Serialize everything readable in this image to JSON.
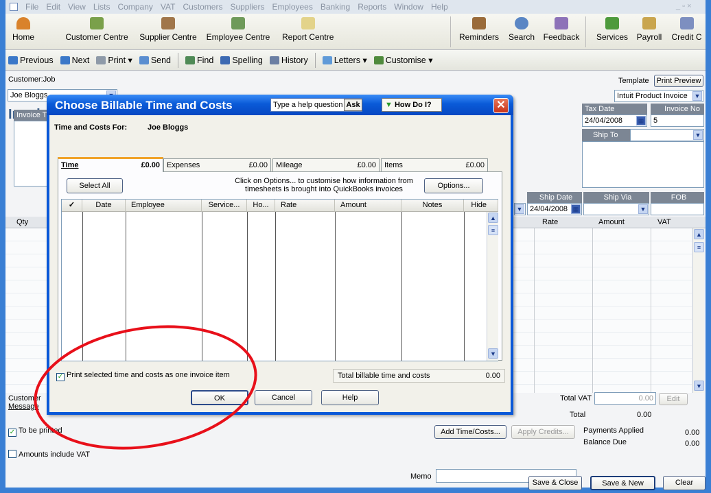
{
  "menu": [
    "File",
    "Edit",
    "View",
    "Lists",
    "Company",
    "VAT",
    "Customers",
    "Suppliers",
    "Employees",
    "Banking",
    "Reports",
    "Window",
    "Help"
  ],
  "icon_toolbar": {
    "left": [
      {
        "label": "Home",
        "icon": "house-icon"
      },
      {
        "label": "Customer Centre",
        "icon": "customer-centre-icon"
      },
      {
        "label": "Supplier Centre",
        "icon": "supplier-centre-icon"
      },
      {
        "label": "Employee Centre",
        "icon": "employee-centre-icon"
      },
      {
        "label": "Report Centre",
        "icon": "report-centre-icon"
      }
    ],
    "right": [
      {
        "label": "Reminders",
        "icon": "reminders-icon"
      },
      {
        "label": "Search",
        "icon": "search-icon"
      },
      {
        "label": "Feedback",
        "icon": "feedback-icon"
      },
      {
        "label": "Services",
        "icon": "services-icon"
      },
      {
        "label": "Payroll",
        "icon": "payroll-icon"
      },
      {
        "label": "Credit C",
        "icon": "credit-card-icon"
      }
    ]
  },
  "action_toolbar": {
    "previous": "Previous",
    "next": "Next",
    "print": "Print",
    "send": "Send",
    "find": "Find",
    "spelling": "Spelling",
    "history": "History",
    "letters": "Letters",
    "customise": "Customise"
  },
  "invoice": {
    "customer_job_label": "Customer:Job",
    "customer_job_value": "Joe Bloggs",
    "title": "Invoi",
    "template_label": "Template",
    "print_preview": "Print Preview",
    "template_value": "Intuit Product Invoice",
    "tax_date_label": "Tax Date",
    "tax_date": "24/04/2008",
    "invoice_no_label": "Invoice No",
    "invoice_no": "5",
    "ship_to_label": "Ship To",
    "invoice_to_label": "Invoice T",
    "ship_date_label": "Ship Date",
    "ship_date": "24/04/2008",
    "ship_via_label": "Ship Via",
    "fob_label": "FOB",
    "col_qty": "Qty",
    "col_rate": "Rate",
    "col_amount": "Amount",
    "col_vat": "VAT",
    "customer_message_label1": "Customer",
    "customer_message_label2": "Message",
    "total_vat_label": "Total VAT",
    "total_vat": "0.00",
    "edit": "Edit",
    "total_label": "Total",
    "total": "0.00",
    "to_be_printed": "To be printed",
    "amounts_include_vat": "Amounts include VAT",
    "add_time_costs": "Add Time/Costs...",
    "apply_credits": "Apply Credits...",
    "payments_applied_label": "Payments Applied",
    "payments_applied": "0.00",
    "balance_due_label": "Balance Due",
    "balance_due": "0.00",
    "memo_label": "Memo",
    "save_close": "Save & Close",
    "save_new": "Save & New",
    "clear": "Clear"
  },
  "dialog": {
    "title": "Choose Billable Time and Costs",
    "help_placeholder": "Type a help question",
    "ask": "Ask",
    "how_do_i": "How Do I?",
    "time_costs_for_label": "Time and Costs For:",
    "time_costs_for_value": "Joe Bloggs",
    "tabs": [
      {
        "label": "Time",
        "amount": "£0.00"
      },
      {
        "label": "Expenses",
        "amount": "£0.00"
      },
      {
        "label": "Mileage",
        "amount": "£0.00"
      },
      {
        "label": "Items",
        "amount": "£0.00"
      }
    ],
    "select_all": "Select All",
    "options_hint_1": "Click on Options... to customise how information from",
    "options_hint_2": "timesheets is brought into QuickBooks invoices",
    "options": "Options...",
    "columns": [
      "✓",
      "Date",
      "Employee",
      "Service...",
      "Ho...",
      "Rate",
      "Amount",
      "Notes",
      "Hide"
    ],
    "print_one_item": "Print selected time and costs as one invoice item",
    "total_billable_label": "Total billable time and costs",
    "total_billable": "0.00",
    "ok": "OK",
    "cancel": "Cancel",
    "help": "Help"
  },
  "colors": {
    "accent": "#0a58d8",
    "highlight_circle": "#e8101a",
    "header_gray": "#7c8694"
  }
}
